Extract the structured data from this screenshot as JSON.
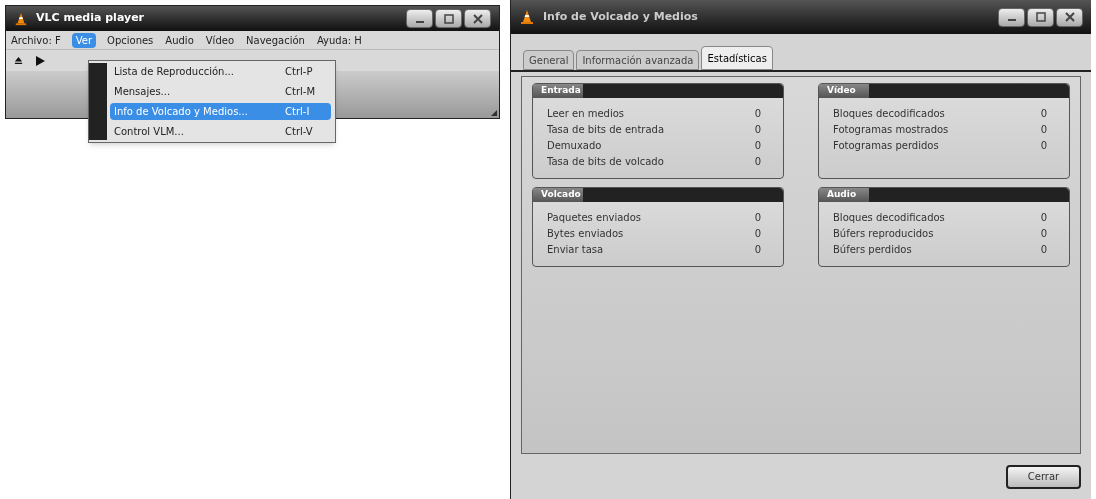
{
  "player_window": {
    "title": "VLC media player",
    "menu": [
      {
        "label": "Archivo: F",
        "selected": false
      },
      {
        "label": "Ver",
        "selected": true
      },
      {
        "label": "Opciones",
        "selected": false
      },
      {
        "label": "Audio",
        "selected": false
      },
      {
        "label": "Vídeo",
        "selected": false
      },
      {
        "label": "Navegación",
        "selected": false
      },
      {
        "label": "Ayuda: H",
        "selected": false
      }
    ],
    "dropdown": [
      {
        "label": "Lista de Reproducción...",
        "shortcut": "Ctrl-P",
        "selected": false
      },
      {
        "label": "Mensajes...",
        "shortcut": "Ctrl-M",
        "selected": false
      },
      {
        "label": "Info de Volcado y Medios...",
        "shortcut": "Ctrl-I",
        "selected": true
      },
      {
        "label": "Control VLM...",
        "shortcut": "Ctrl-V",
        "selected": false
      }
    ]
  },
  "info_window": {
    "title": "Info de Volcado y Medios",
    "tabs": [
      {
        "label": "General",
        "selected": false
      },
      {
        "label": "Información avanzada",
        "selected": false
      },
      {
        "label": "Estadísticas",
        "selected": true
      }
    ],
    "groups": [
      {
        "title": "Entrada",
        "rows": [
          {
            "label": "Leer en medios",
            "value": "0"
          },
          {
            "label": "Tasa de bits de entrada",
            "value": "0"
          },
          {
            "label": "Demuxado",
            "value": "0"
          },
          {
            "label": "Tasa de bits de volcado",
            "value": "0"
          }
        ]
      },
      {
        "title": "Vídeo",
        "rows": [
          {
            "label": "Bloques decodificados",
            "value": "0"
          },
          {
            "label": "Fotogramas mostrados",
            "value": "0"
          },
          {
            "label": "Fotogramas perdidos",
            "value": "0"
          }
        ]
      },
      {
        "title": "Volcado",
        "rows": [
          {
            "label": "Paquetes enviados",
            "value": "0"
          },
          {
            "label": "Bytes enviados",
            "value": "0"
          },
          {
            "label": "Enviar tasa",
            "value": "0"
          }
        ]
      },
      {
        "title": "Audio",
        "rows": [
          {
            "label": "Bloques decodificados",
            "value": "0"
          },
          {
            "label": "Búfers reproducidos",
            "value": "0"
          },
          {
            "label": "Búfers perdidos",
            "value": "0"
          }
        ]
      }
    ],
    "close_button": "Cerrar"
  }
}
